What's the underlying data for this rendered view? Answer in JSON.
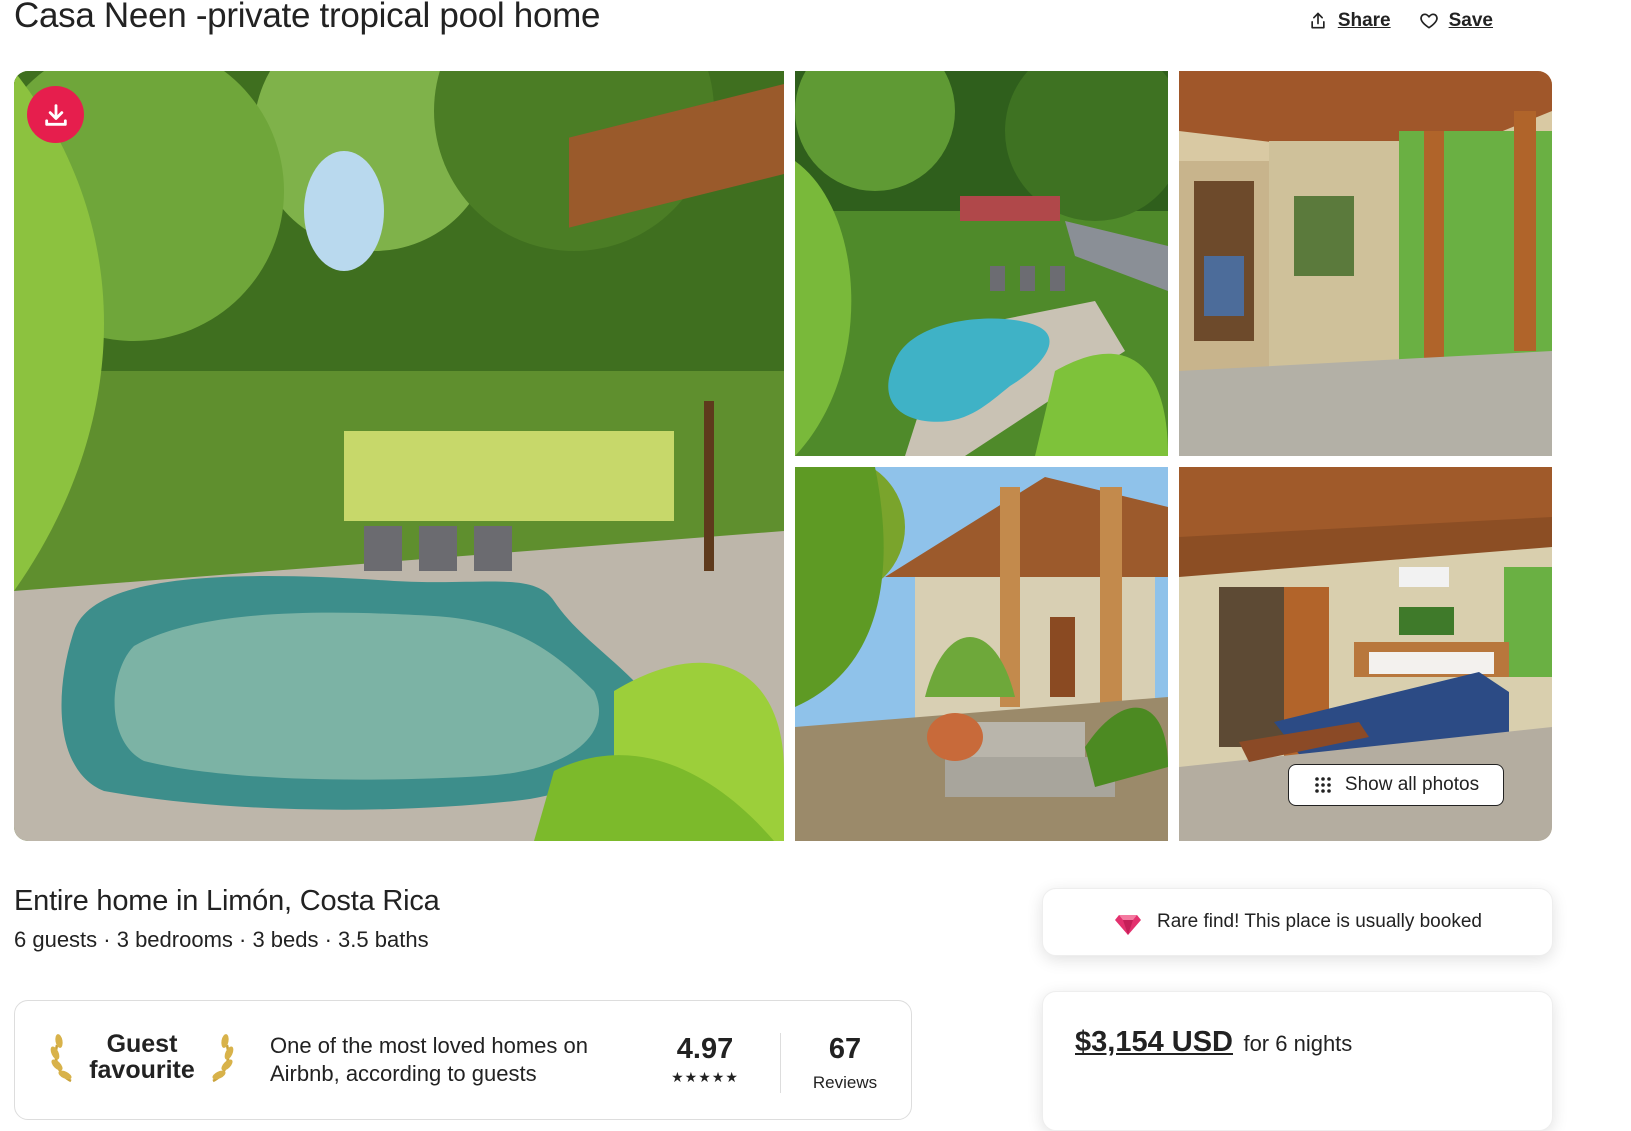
{
  "listing": {
    "title": "Casa Neen -private tropical pool home",
    "subtitle": "Entire home in Limón, Costa Rica",
    "details": "6 guests · 3 bedrooms · 3 beds · 3.5 baths"
  },
  "header_actions": {
    "share_label": "Share",
    "save_label": "Save"
  },
  "gallery": {
    "show_all_label": "Show all photos",
    "photos": [
      "pool-garden",
      "pool-aerial",
      "open-corridor",
      "house-exterior",
      "bedroom"
    ]
  },
  "guest_favourite": {
    "badge_line1": "Guest",
    "badge_line2": "favourite",
    "description": "One of the most loved homes on Airbnb, according to guests",
    "rating": "4.97",
    "stars": "★★★★★",
    "reviews_count": "67",
    "reviews_label": "Reviews"
  },
  "rare_find": {
    "text": "Rare find! This place is usually booked",
    "icon": "gem-icon"
  },
  "price": {
    "amount": "$3,154 USD",
    "period": "for 6 nights"
  },
  "icons": {
    "share": "share-icon",
    "save": "heart-icon",
    "download": "download-icon",
    "grid": "grid-icon",
    "laurel": "laurel-icon"
  },
  "colors": {
    "brand": "#e61e4d",
    "text": "#222222",
    "border": "#dddddd",
    "gem": "#e3316e"
  }
}
